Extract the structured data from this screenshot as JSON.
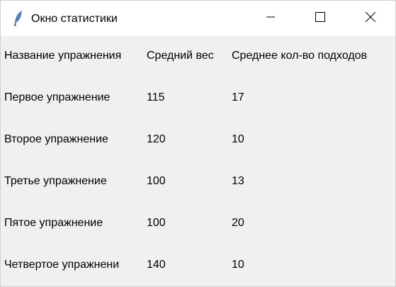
{
  "window": {
    "title": "Окно статистики",
    "icon": "feather-icon",
    "controls": [
      "minimize-icon",
      "maximize-icon",
      "close-icon"
    ]
  },
  "table": {
    "headers": [
      "Название упражнения",
      "Средний вес",
      "Среднее кол-во подходов"
    ],
    "rows": [
      [
        "Первое упражнение",
        "115",
        "17"
      ],
      [
        "Второе упражнение",
        "120",
        "10"
      ],
      [
        "Третье упражнение",
        "100",
        "13"
      ],
      [
        "Пятое упражнение",
        "100",
        "20"
      ],
      [
        "Четвертое упражнени",
        "140",
        "10"
      ]
    ]
  }
}
